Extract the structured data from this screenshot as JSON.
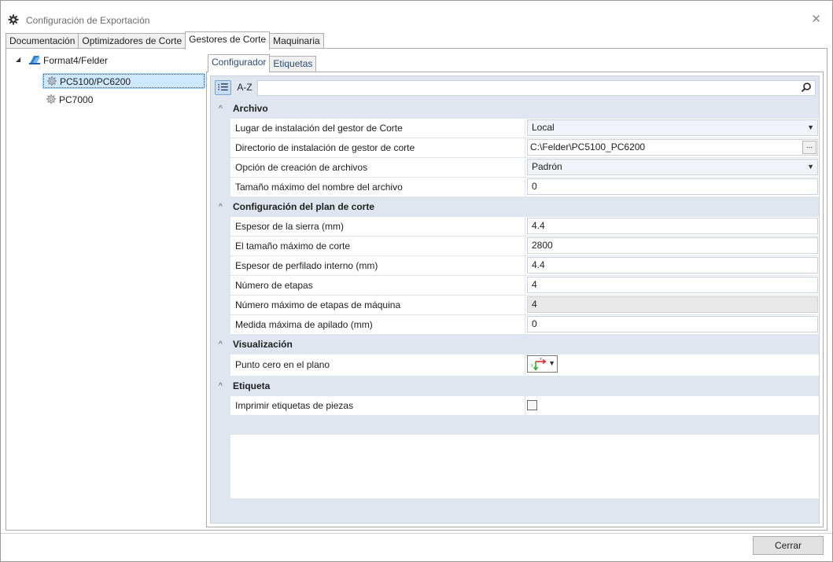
{
  "window": {
    "title": "Configuración de Exportación",
    "close_glyph": "✕"
  },
  "main_tabs": [
    {
      "label": "Documentación",
      "active": false
    },
    {
      "label": "Optimizadores de Corte",
      "active": false
    },
    {
      "label": "Gestores de Corte",
      "active": true
    },
    {
      "label": "Maquinaria",
      "active": false
    }
  ],
  "tree": {
    "root": {
      "label": "Format4/Felder",
      "icon": "folder-app-icon",
      "expander": "◢"
    },
    "children": [
      {
        "label": "PC5100/PC6200",
        "icon": "gear-icon",
        "selected": true
      },
      {
        "label": "PC7000",
        "icon": "gear-icon",
        "selected": false
      }
    ]
  },
  "sub_tabs": [
    {
      "label": "Configurador",
      "active": true
    },
    {
      "label": "Etiquetas",
      "active": false
    }
  ],
  "property_grid": {
    "toolbar": {
      "categorized_label": "⁝☰",
      "alphabetical_label": "A-Z",
      "search_placeholder": "",
      "search_icon": "⚲"
    },
    "categories": [
      {
        "name": "Archivo",
        "chevron": "^",
        "properties": [
          {
            "name": "Lugar de instalación del gestor de Corte",
            "value": "Local",
            "kind": "combo"
          },
          {
            "name": "Directorio de instalación de gestor de corte",
            "value": "C:\\Felder\\PC5100_PC6200",
            "kind": "path"
          },
          {
            "name": "Opción de creación de archivos",
            "value": "Padrón",
            "kind": "combo"
          },
          {
            "name": "Tamaño máximo del nombre del archivo",
            "value": "0",
            "kind": "text"
          }
        ]
      },
      {
        "name": "Configuración del plan de corte",
        "chevron": "^",
        "properties": [
          {
            "name": "Espesor de la sierra (mm)",
            "value": "4.4",
            "kind": "text"
          },
          {
            "name": "El tamaño máximo de corte",
            "value": "2800",
            "kind": "text"
          },
          {
            "name": "Espesor de perfilado interno (mm)",
            "value": "4.4",
            "kind": "text"
          },
          {
            "name": "Número de etapas",
            "value": "4",
            "kind": "text"
          },
          {
            "name": "Número máximo de etapas de máquina",
            "value": "4",
            "kind": "readonly"
          },
          {
            "name": "Medida máxima de apilado (mm)",
            "value": "0",
            "kind": "text"
          }
        ]
      },
      {
        "name": "Visualización",
        "chevron": "^",
        "properties": [
          {
            "name": "Punto cero en el plano",
            "value": "",
            "kind": "origin",
            "icon": "xy-origin-icon"
          }
        ]
      },
      {
        "name": "Etiqueta",
        "chevron": "^",
        "properties": [
          {
            "name": "Imprimir etiquetas de piezas",
            "value": "",
            "kind": "checkbox",
            "checked": false
          }
        ]
      }
    ],
    "combo_arrow": "▼",
    "ellipsis": "..."
  },
  "footer": {
    "close_label": "Cerrar"
  }
}
